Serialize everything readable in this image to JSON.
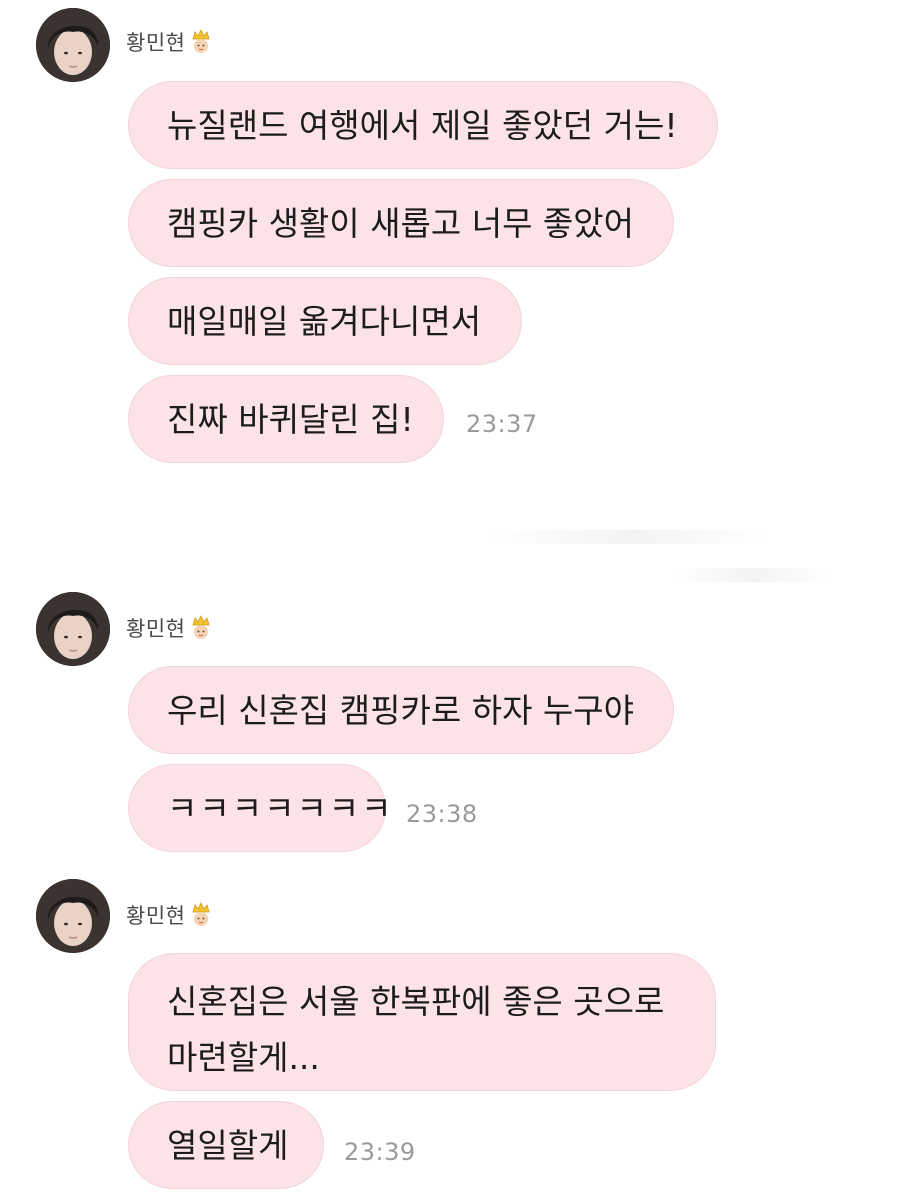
{
  "groups": [
    {
      "sender": "황민현",
      "sender_badge": "crown-face-icon",
      "messages": [
        {
          "lines": [
            "뉴질랜드 여행에서 제일 좋았던 거는!"
          ]
        },
        {
          "lines": [
            "캠핑카 생활이 새롭고 너무 좋았어"
          ]
        },
        {
          "lines": [
            "매일매일 옮겨다니면서"
          ]
        },
        {
          "lines": [
            "진짜 바퀴달린 집!"
          ]
        }
      ],
      "time": "23:37"
    },
    {
      "sender": "황민현",
      "sender_badge": "crown-face-icon",
      "messages": [
        {
          "lines": [
            "우리 신혼집 캠핑카로 하자 누구야"
          ]
        },
        {
          "lines": [
            "ㅋㅋㅋㅋㅋㅋㅋ"
          ]
        }
      ],
      "time": "23:38"
    },
    {
      "sender": "황민현",
      "sender_badge": "crown-face-icon",
      "messages": [
        {
          "lines": [
            "신혼집은 서울 한복판에 좋은 곳으로",
            "마련할게..."
          ]
        },
        {
          "lines": [
            "열일할게"
          ]
        }
      ],
      "time": "23:39"
    }
  ],
  "colors": {
    "bubble_background": "#fbe3e8",
    "bubble_border": "#f3d3da",
    "text": "#1c1c1c",
    "timestamp": "#9a9a9a"
  }
}
